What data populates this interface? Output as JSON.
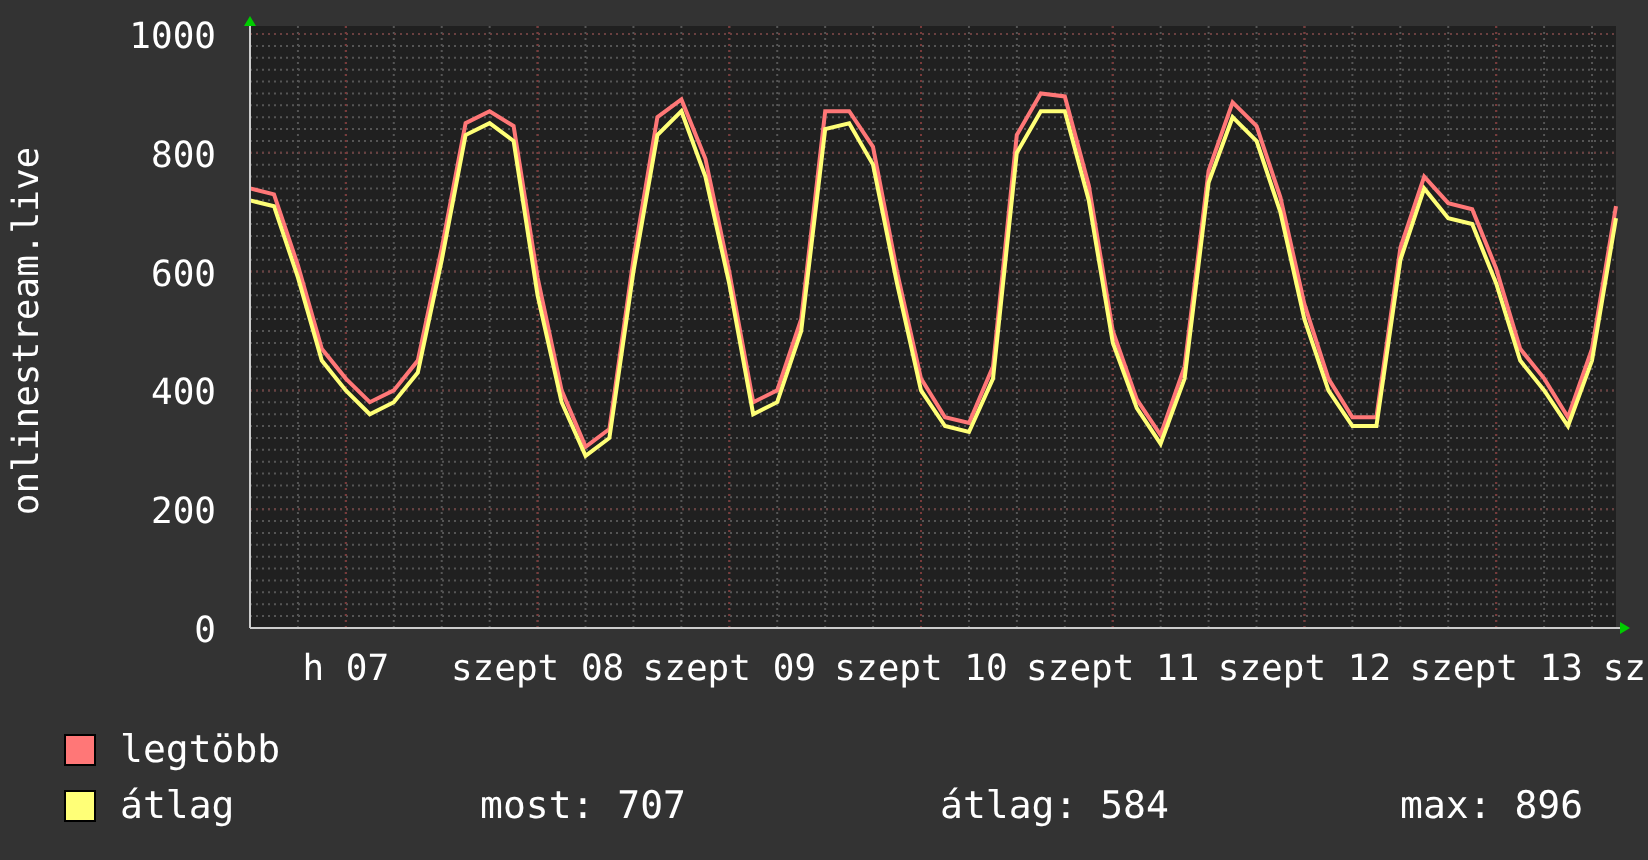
{
  "chart": {
    "chart_data": {
      "type": "line",
      "ylabel": "onlinestream.live",
      "categories": [
        null,
        null,
        null,
        null,
        "h 07",
        null,
        null,
        null,
        null,
        null,
        null,
        null,
        "szept 08",
        null,
        null,
        null,
        null,
        null,
        null,
        null,
        "szept 09",
        null,
        null,
        null,
        null,
        null,
        null,
        null,
        "szept 10",
        null,
        null,
        null,
        null,
        null,
        null,
        null,
        "szept 11",
        null,
        null,
        null,
        null,
        null,
        null,
        null,
        "szept 12",
        null,
        null,
        null,
        null,
        null,
        null,
        null,
        "szept 13",
        null,
        null,
        null,
        null,
        "sz"
      ],
      "series": [
        {
          "name": "legtöbb",
          "color": "#ff7777",
          "values": [
            740,
            730,
            610,
            470,
            420,
            380,
            400,
            450,
            640,
            850,
            870,
            845,
            590,
            400,
            305,
            335,
            620,
            860,
            890,
            790,
            600,
            380,
            400,
            520,
            870,
            870,
            810,
            600,
            420,
            355,
            345,
            440,
            830,
            900,
            895,
            745,
            500,
            385,
            325,
            440,
            770,
            885,
            845,
            725,
            545,
            420,
            355,
            355,
            640,
            760,
            715,
            705,
            605,
            470,
            420,
            355,
            470,
            710
          ]
        },
        {
          "name": "átlag",
          "color": "#ffff77",
          "values": [
            720,
            710,
            590,
            450,
            400,
            360,
            380,
            430,
            620,
            830,
            850,
            820,
            560,
            380,
            290,
            320,
            600,
            830,
            870,
            760,
            580,
            360,
            380,
            500,
            840,
            850,
            780,
            580,
            400,
            340,
            330,
            420,
            800,
            870,
            870,
            720,
            480,
            370,
            310,
            420,
            750,
            860,
            820,
            700,
            520,
            400,
            340,
            340,
            620,
            740,
            690,
            680,
            580,
            450,
            400,
            340,
            450,
            690
          ]
        }
      ],
      "ylim": [
        0,
        1000
      ],
      "grid": true,
      "yticks": [
        0,
        200,
        400,
        600,
        800,
        1000
      ]
    }
  },
  "stats": [
    "most: 707",
    "átlag: 584",
    "max: 896"
  ]
}
